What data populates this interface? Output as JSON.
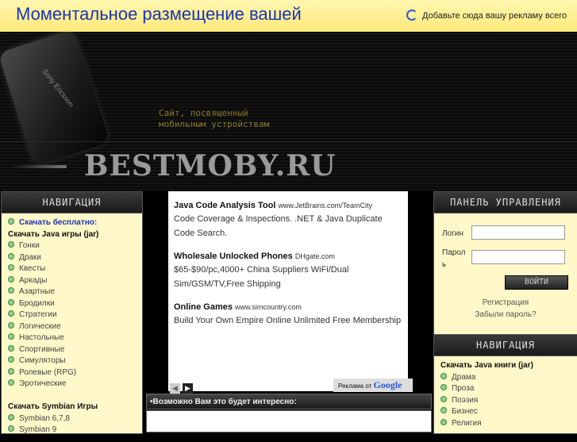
{
  "topbar": {
    "headline": "Моментальное размещение вашей",
    "ad_link": "Добавьте сюда вашу рекламу всего"
  },
  "header": {
    "phone_brand": "Sony Ericsson",
    "slogan": "Сайт, посвященный мобильным устройствам",
    "logo": "BESTMOBY.RU"
  },
  "left_nav": {
    "title": "НАВИГАЦИЯ",
    "items": [
      {
        "label": "Скачать бесплатно:",
        "kind": "link"
      },
      {
        "label": "Скачать Java игры (jar)",
        "kind": "head"
      },
      {
        "label": "Гонки",
        "kind": "item"
      },
      {
        "label": "Драки",
        "kind": "item"
      },
      {
        "label": "Квесты",
        "kind": "item"
      },
      {
        "label": "Аркады",
        "kind": "item"
      },
      {
        "label": "Азартные",
        "kind": "item"
      },
      {
        "label": "Бродилки",
        "kind": "item"
      },
      {
        "label": "Стратегии",
        "kind": "item"
      },
      {
        "label": "Логические",
        "kind": "item"
      },
      {
        "label": "Настольные",
        "kind": "item"
      },
      {
        "label": "Спортивные",
        "kind": "item"
      },
      {
        "label": "Симуляторы",
        "kind": "item"
      },
      {
        "label": "Ролевые (RPG)",
        "kind": "item"
      },
      {
        "label": "Эротические",
        "kind": "item"
      },
      {
        "label": "",
        "kind": "spacer"
      },
      {
        "label": "Скачать Symbian Игры",
        "kind": "head"
      },
      {
        "label": "Symbian 6,7,8",
        "kind": "item"
      },
      {
        "label": "Symbian 9",
        "kind": "item"
      }
    ]
  },
  "ads": [
    {
      "title": "Java Code Analysis Tool",
      "domain": "www.JetBrains.com/TeamCity",
      "body": "Code Coverage & Inspections. .NET & Java Duplicate Code Search."
    },
    {
      "title": "Wholesale Unlocked Phones",
      "domain": "DHgate.com",
      "body": "$65-$90/pc,4000+ China Suppliers WiFi/Dual Sim/GSM/TV,Free Shipping"
    },
    {
      "title": "Online Games",
      "domain": "www.simcountry.com",
      "body": "Build Your Own Empire Online Unlimited Free Membership"
    }
  ],
  "ad_nav": {
    "prev": "◀",
    "next": "▶"
  },
  "ad_badge": {
    "text": "Реклама от",
    "brand": "Google"
  },
  "interest": {
    "title": "•Возможно Вам это будет интересно:"
  },
  "control_panel": {
    "title": "ПАНЕЛЬ УПРАВЛЕНИЯ",
    "login_label": "Логин",
    "password_label": "Парол ь",
    "submit": "ВОЙТИ",
    "register": "Регистрация",
    "forgot": "Забыли пароль?"
  },
  "right_nav": {
    "title": "НАВИГАЦИЯ",
    "items": [
      {
        "label": "Скачать Java книги (jar)",
        "kind": "head"
      },
      {
        "label": "Драма",
        "kind": "item"
      },
      {
        "label": "Проза",
        "kind": "item"
      },
      {
        "label": "Поэзия",
        "kind": "item"
      },
      {
        "label": "Бизнес",
        "kind": "item"
      },
      {
        "label": "Религия",
        "kind": "item"
      }
    ]
  },
  "colors": {
    "accent_link": "#1a33b8",
    "panel_bg": "#fff8c8",
    "topbar_bg": "#ffe97a"
  }
}
